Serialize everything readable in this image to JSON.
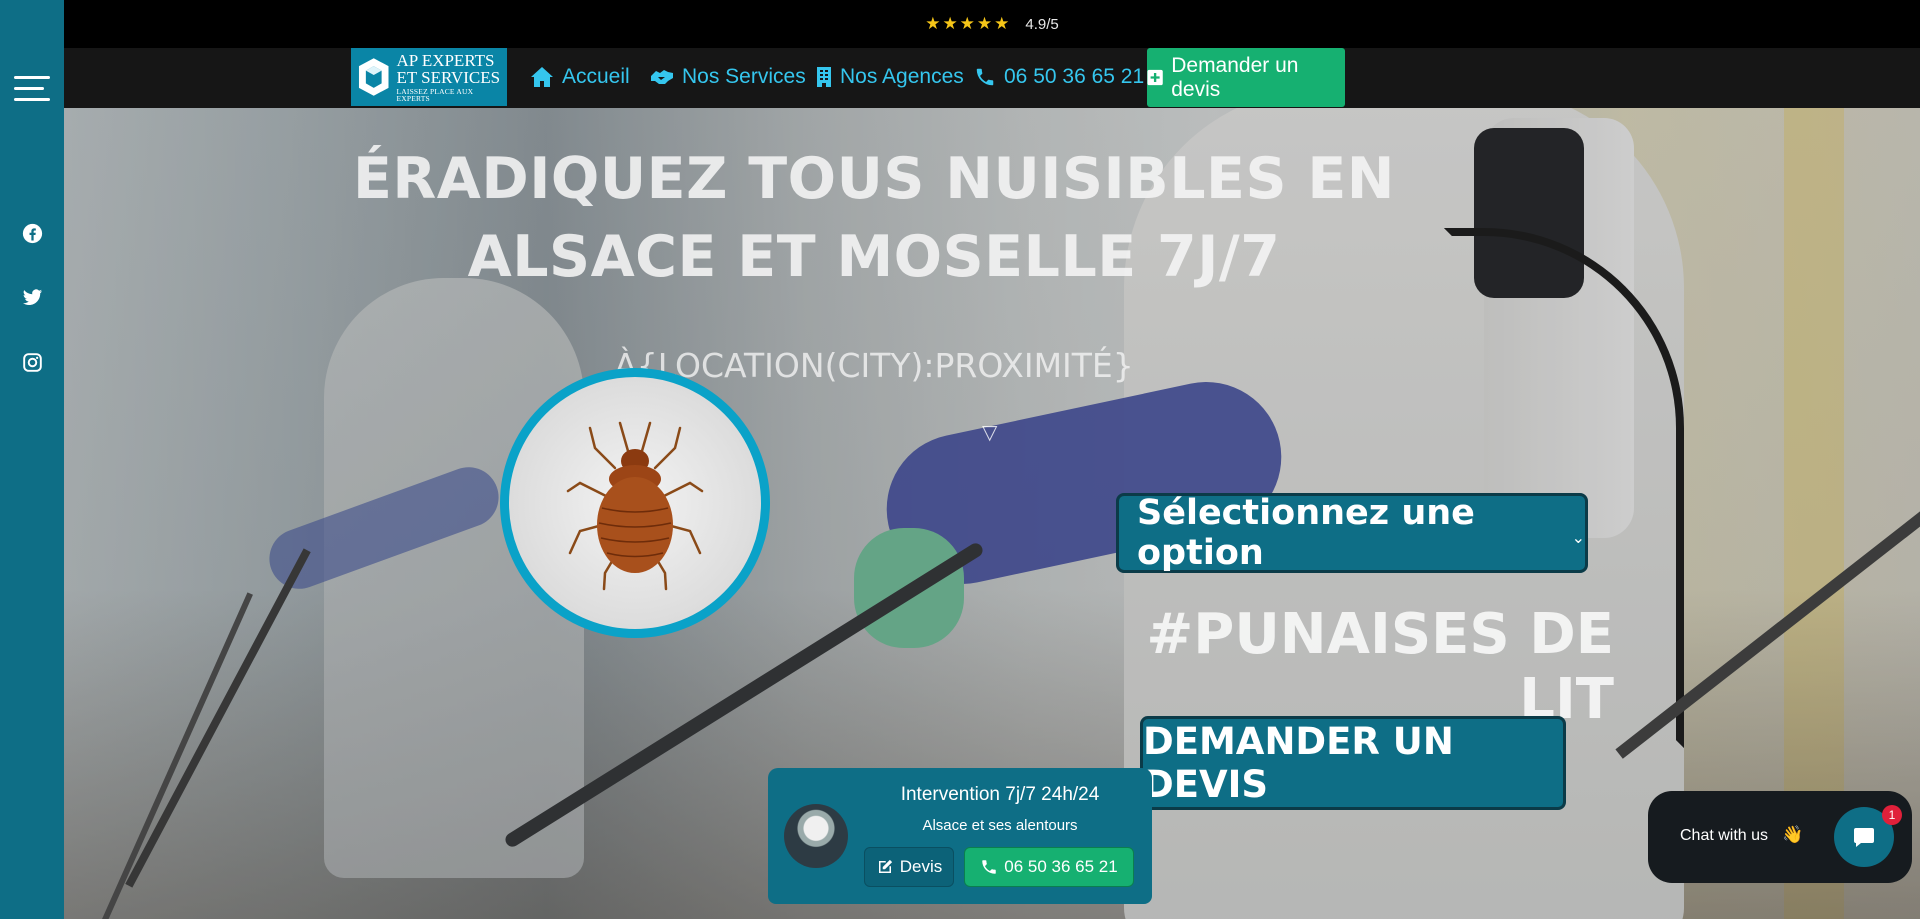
{
  "topbar": {
    "stars": "★★★★★",
    "rating": "4.9/5"
  },
  "logo": {
    "line1": "AP EXPERTS",
    "line2": "ET SERVICES",
    "tagline": "LAISSEZ PLACE AUX EXPERTS"
  },
  "nav": {
    "home": "Accueil",
    "services": "Nos Services",
    "agencies": "Nos Agences",
    "phone": "06 50 36 65 21",
    "quote": "Demander un devis"
  },
  "hero": {
    "title": "ÉRADIQUEZ TOUS NUISIBLES EN ALSACE ET MOSELLE 7J/7",
    "subtitle": "À{LOCATION(CITY):PROXIMITÉ}",
    "arrow": "▽",
    "select_label": "Sélectionnez une option",
    "tag": "#PUNAISES DE LIT",
    "cta": "DEMANDER UN DEVIS"
  },
  "card": {
    "title": "Intervention 7j/7 24h/24",
    "subtitle": "Alsace et ses alentours",
    "devis": "Devis",
    "phone": "06 50 36 65 21"
  },
  "chat": {
    "label": "Chat with us",
    "wave": "👋",
    "badge": "1"
  },
  "colors": {
    "sidebar": "#0e6e86",
    "nav_link": "#35c6ee",
    "green": "#16b071",
    "circle_border": "#0aa2c8"
  }
}
